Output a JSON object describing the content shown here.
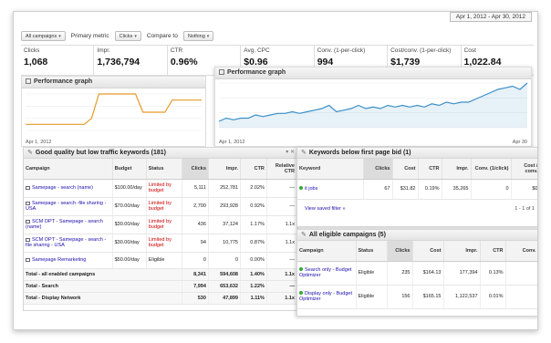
{
  "header": {
    "date_range": "Apr 1, 2012 - Apr 30, 2012"
  },
  "filters": {
    "campaigns_dropdown": "All campaigns",
    "primary_metric_label": "Primary metric",
    "primary_metric_value": "Clicks",
    "compare_label": "Compare to",
    "compare_value": "Nothing"
  },
  "metrics": [
    {
      "label": "Clicks",
      "value": "1,068"
    },
    {
      "label": "Impr.",
      "value": "1,736,794"
    },
    {
      "label": "CTR",
      "value": "0.96%"
    },
    {
      "label": "Avg. CPC",
      "value": "$0.96"
    },
    {
      "label": "Conv. (1-per-click)",
      "value": "994"
    },
    {
      "label": "Cost/conv. (1-per-click)",
      "value": "$1,739"
    },
    {
      "label": "Cost",
      "value": "1,022.84"
    }
  ],
  "graph_small": {
    "title": "Performance graph",
    "start_label": "Apr 1, 2012",
    "color": "#e69a2a",
    "values": [
      1,
      1,
      1,
      1,
      1,
      1,
      1,
      1,
      1,
      2,
      6,
      6,
      6,
      6,
      6,
      6,
      3,
      3,
      3,
      3,
      5,
      5,
      5,
      5,
      5
    ]
  },
  "graph_large": {
    "title": "Performance graph",
    "start_label": "Apr 1, 2012",
    "end_label": "Apr 30",
    "color": "#3a8fc7",
    "values": [
      2,
      3,
      2.5,
      3,
      3,
      4,
      3.5,
      4,
      4.5,
      4.5,
      5,
      4.5,
      5,
      5.5,
      6,
      7,
      5,
      5.5,
      6,
      7,
      6,
      6.5,
      6,
      7,
      6.5,
      7,
      6.5,
      7,
      6.5,
      7.5,
      7,
      8,
      7.5,
      8,
      8,
      9,
      10,
      11,
      12,
      12.5,
      13,
      12,
      14
    ]
  },
  "keywords_panel": {
    "title": "Good quality but low traffic keywords (181)",
    "columns": [
      "Campaign",
      "Budget",
      "Status",
      "Clicks",
      "Impr.",
      "CTR",
      "Relative CTR"
    ],
    "rows": [
      {
        "campaign": "Samepage - search (name)",
        "budget": "$100.00/day",
        "status": "Limited by budget",
        "clicks": "5,111",
        "impr": "252,781",
        "ctr": "2.02%",
        "rel": "—"
      },
      {
        "campaign": "Samepage - search -file sharing - USA",
        "budget": "$70.00/day",
        "status": "Limited by budget",
        "clicks": "2,700",
        "impr": "293,928",
        "ctr": "0.92%",
        "rel": "—"
      },
      {
        "campaign": "SCM OPT - Samepage - search (name)",
        "budget": "$30.00/day",
        "status": "Limited by budget",
        "clicks": "436",
        "impr": "37,124",
        "ctr": "1.17%",
        "rel": "1.1x"
      },
      {
        "campaign": "SCM OPT - Samepage - search -file sharing - USA",
        "budget": "$30.00/day",
        "status": "Limited by budget",
        "clicks": "94",
        "impr": "10,775",
        "ctr": "0.87%",
        "rel": "1.1x"
      },
      {
        "campaign": "Samepage Remarketing",
        "budget": "$50.00/day",
        "status": "Eligible",
        "clicks": "0",
        "impr": "0",
        "ctr": "0.00%",
        "rel": "—"
      }
    ],
    "totals": [
      {
        "label": "Total - all enabled campaigns",
        "clicks": "8,341",
        "impr": "594,608",
        "ctr": "1.40%",
        "rel": "1.1x"
      },
      {
        "label": "Total - Search",
        "clicks": "7,994",
        "impr": "653,632",
        "ctr": "1.22%",
        "rel": "—"
      },
      {
        "label": "Total - Display Network",
        "clicks": "530",
        "impr": "47,899",
        "ctr": "1.11%",
        "rel": "1.1x"
      }
    ]
  },
  "bid_panel": {
    "title": "Keywords below first page bid (1)",
    "columns": [
      "Keyword",
      "Clicks",
      "Cost",
      "CTR",
      "Impr.",
      "Conv. (1/click)",
      "Cost / conv."
    ],
    "rows": [
      {
        "keyword": "it jobs",
        "clicks": "67",
        "cost": "$31.82",
        "ctr": "0.19%",
        "impr": "35,265",
        "conv": "0",
        "costconv": "$0"
      }
    ],
    "saved_filter": "View saved filter »",
    "pagination": "1 - 1 of 1"
  },
  "eligible_panel": {
    "title": "All eligible campaigns (5)",
    "columns": [
      "Campaign",
      "Status",
      "Clicks",
      "Cost",
      "Impr.",
      "CTR",
      "Conv."
    ],
    "rows": [
      {
        "campaign": "Search only - Budget Optimizer",
        "status": "Eligible",
        "clicks": "235",
        "cost": "$164.13",
        "impr": "177,394",
        "ctr": "0.13%",
        "conv": ""
      },
      {
        "campaign": "Display only - Budget Optimizer",
        "status": "Eligible",
        "clicks": "156",
        "cost": "$165.15",
        "impr": "1,122,537",
        "ctr": "0.01%",
        "conv": ""
      }
    ]
  }
}
